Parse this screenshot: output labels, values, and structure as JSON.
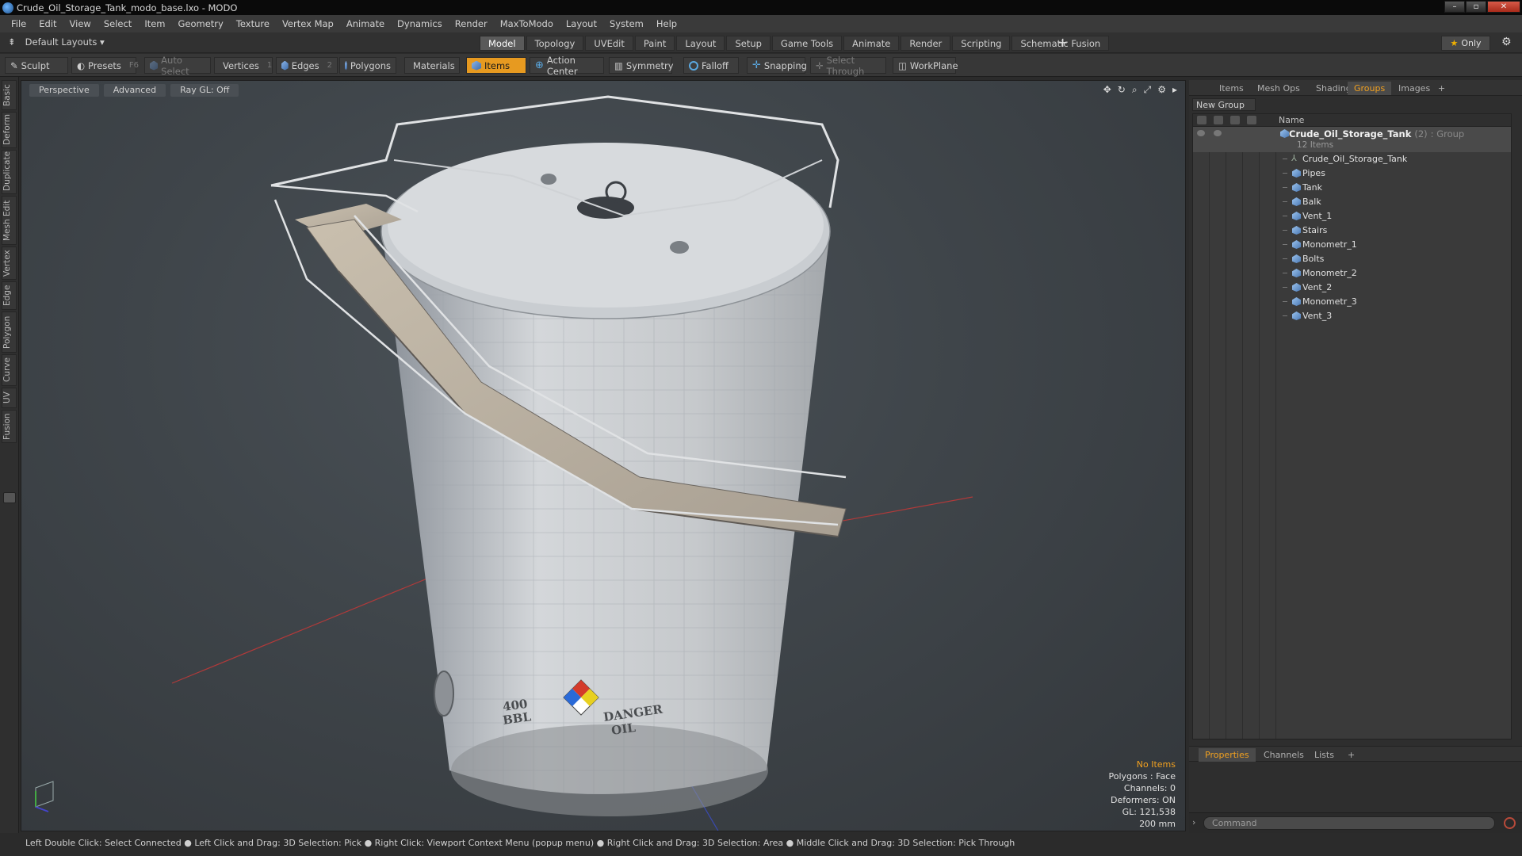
{
  "window": {
    "title": "Crude_Oil_Storage_Tank_modo_base.lxo - MODO",
    "minimize": "–",
    "maximize": "▫",
    "close": "✕"
  },
  "menu": [
    "File",
    "Edit",
    "View",
    "Select",
    "Item",
    "Geometry",
    "Texture",
    "Vertex Map",
    "Animate",
    "Dynamics",
    "Render",
    "MaxToModo",
    "Layout",
    "System",
    "Help"
  ],
  "layout_row": {
    "layouts_label": "Default Layouts ▾",
    "tabs": [
      "Model",
      "Topology",
      "UVEdit",
      "Paint",
      "Layout",
      "Setup",
      "Game Tools",
      "Animate",
      "Render",
      "Scripting",
      "Schematic Fusion"
    ],
    "active_tab": "Model",
    "add": "+",
    "only_label": "Only"
  },
  "toolbar": {
    "sculpt": "Sculpt",
    "presets": "Presets",
    "presets_key": "F6",
    "auto_select": "Auto Select",
    "vertices": "Vertices",
    "vertices_count": "1",
    "edges": "Edges",
    "edges_count": "2",
    "polygons": "Polygons",
    "materials": "Materials",
    "items": "Items",
    "action_center": "Action Center",
    "symmetry": "Symmetry",
    "falloff": "Falloff",
    "snapping": "Snapping",
    "select_through": "Select Through",
    "workplane": "WorkPlane"
  },
  "left_tabs": [
    "Basic",
    "Deform",
    "Duplicate",
    "Mesh Edit",
    "Vertex",
    "Edge",
    "Polygon",
    "Curve",
    "UV",
    "Fusion"
  ],
  "viewport": {
    "view": "Perspective",
    "shading": "Advanced",
    "raygl": "Ray GL: Off",
    "info": {
      "no_items": "No Items",
      "polygons": "Polygons : Face",
      "channels": "Channels: 0",
      "deformers": "Deformers: ON",
      "gl": "GL: 121,538",
      "size": "200 mm"
    },
    "tank_label": {
      "bbl": "400\nBBL",
      "danger": "DANGER\nOIL",
      "hazard": [
        "1",
        "4",
        "0"
      ]
    }
  },
  "right_panel": {
    "tabs": [
      "Items",
      "Mesh Ops",
      "Shading",
      "Groups",
      "Images"
    ],
    "active_tab": "Groups",
    "add": "+",
    "new_group": "New Group",
    "column_name": "Name",
    "group": {
      "name": "Crude_Oil_Storage_Tank",
      "count": "(2)",
      "type": ": Group",
      "sub": "12 Items"
    },
    "items": [
      "Crude_Oil_Storage_Tank",
      "Pipes",
      "Tank",
      "Balk",
      "Vent_1",
      "Stairs",
      "Monometr_1",
      "Bolts",
      "Monometr_2",
      "Vent_2",
      "Monometr_3",
      "Vent_3"
    ],
    "bottom_tabs": [
      "Properties",
      "Channels",
      "Lists"
    ],
    "bottom_active": "Properties",
    "command_placeholder": "Command"
  },
  "status": "Left Double Click: Select Connected ● Left Click and Drag: 3D Selection: Pick ● Right Click: Viewport Context Menu (popup menu) ● Right Click and Drag: 3D Selection: Area ● Middle Click and Drag: 3D Selection: Pick Through"
}
